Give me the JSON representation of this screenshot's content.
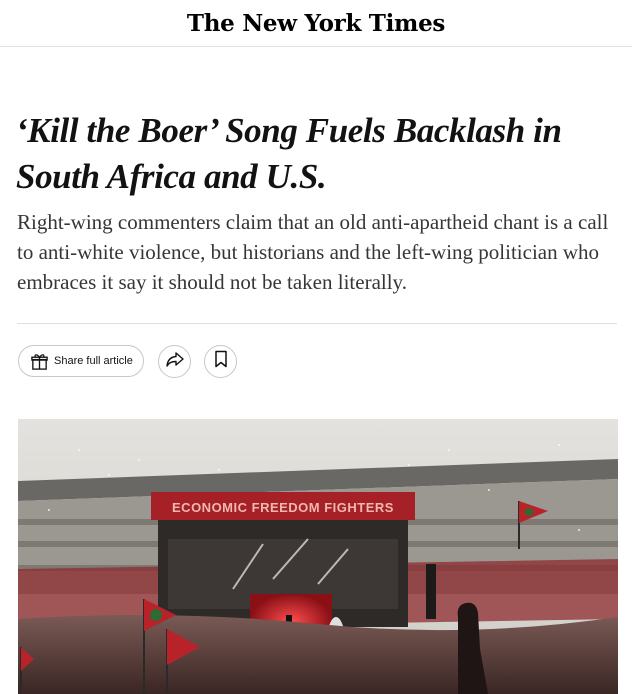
{
  "masthead": {
    "logo_text": "The New York Times"
  },
  "article": {
    "headline": "‘Kill the Boer’ Song Fuels Backlash in South Africa and U.S.",
    "summary": "Right-wing commenters claim that an old anti-apartheid chant is a call to anti-white violence, but historians and the left-wing politician who embraces it say it should not be taken literally."
  },
  "actions": {
    "share_full_label": "Share full article",
    "share_icon": "share-arrow-icon",
    "save_icon": "bookmark-icon",
    "gift_icon": "gift-icon"
  },
  "photo": {
    "banner_text": "ECONOMIC FREEDOM FIGHTERS"
  },
  "colors": {
    "text": "#121212",
    "summary_text": "#363636",
    "border": "#c7c7c7",
    "flag_red": "#b8232a",
    "flag_green": "#2e6b34"
  }
}
